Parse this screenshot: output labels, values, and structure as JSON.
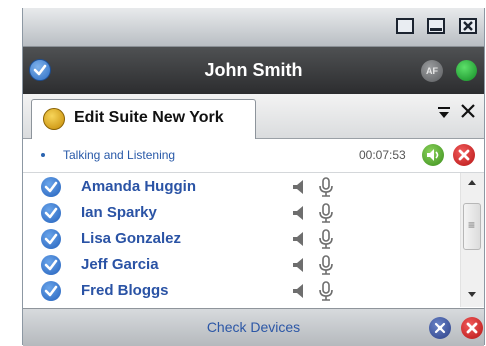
{
  "window": {
    "controls": [
      "restore-icon",
      "minimize-icon",
      "close-icon"
    ]
  },
  "user": {
    "name": "John Smith",
    "af_badge": "AF",
    "status_color": "#1fa233"
  },
  "tab": {
    "label": "Edit Suite New York",
    "menu_icon": "dropdown-icon",
    "close_icon": "close-icon"
  },
  "call": {
    "status": "Talking and Listening",
    "timer": "00:07:53"
  },
  "participants": [
    {
      "name": "Amanda Huggin"
    },
    {
      "name": "Ian Sparky"
    },
    {
      "name": "Lisa Gonzalez"
    },
    {
      "name": "Jeff Garcia"
    },
    {
      "name": "Fred Bloggs"
    }
  ],
  "footer": {
    "check_devices": "Check Devices"
  },
  "colors": {
    "accent": "#2a53a5",
    "hangup": "#d42020",
    "speaker": "#46a02a"
  }
}
